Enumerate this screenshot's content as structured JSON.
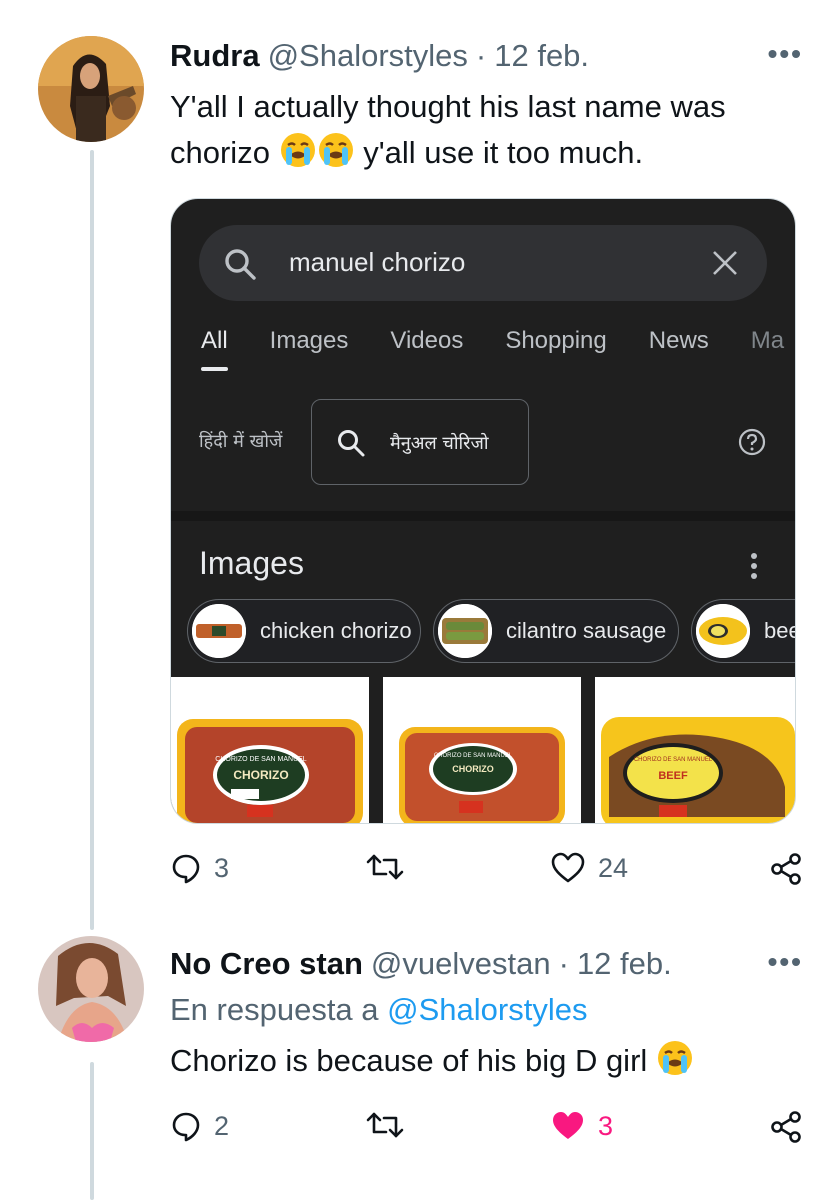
{
  "tweets": [
    {
      "name": "Rudra",
      "handle": "@Shalorstyles",
      "separator": "·",
      "date": "12 feb.",
      "more": "•••",
      "text_line1": "Y'all I actually thought his last name was",
      "text_line2_a": "chorizo",
      "text_line2_b": "y'all use it too much.",
      "emoji": "loudly-crying-face",
      "stats": {
        "replies": "3",
        "retweets": "",
        "likes": "24"
      },
      "media": {
        "search_query": "manuel chorizo",
        "tabs": [
          "All",
          "Images",
          "Videos",
          "Shopping",
          "News",
          "Ma"
        ],
        "active_tab": "All",
        "hindi_label": "हिंदी में खोजें",
        "hindi_query": "मैनुअल चोरिजो",
        "images_heading": "Images",
        "chips": [
          "chicken chorizo",
          "cilantro sausage",
          "bee"
        ],
        "product_label": "CHORIZO",
        "product_brand": "CHORIZO DE SAN MANUEL",
        "product_label_beef": "BEEF"
      }
    },
    {
      "name": "No Creo stan",
      "handle": "@vuelvestan",
      "separator": "·",
      "date": "12 feb.",
      "more": "•••",
      "reply_prefix": "En respuesta a",
      "reply_handle": "@Shalorstyles",
      "text": "Chorizo is because of his big D girl",
      "emoji": "loudly-crying-face",
      "stats": {
        "replies": "2",
        "retweets": "",
        "likes": "3"
      },
      "liked": true
    }
  ],
  "colors": {
    "text": "#0f1419",
    "secondary": "#536471",
    "link": "#1d9bf0",
    "like_active": "#f91880",
    "thread_line": "#cfd9de",
    "search_bg": "#303134",
    "dark_bg": "#1f1f1f"
  }
}
